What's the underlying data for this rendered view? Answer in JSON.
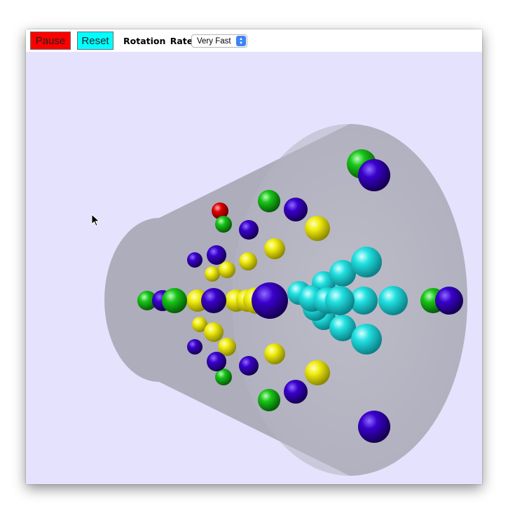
{
  "toolbar": {
    "pause_label": "Pause",
    "reset_label": "Reset",
    "rotation_rate_label": "Rotation Rate",
    "rotation_rate_value": "Very Fast"
  },
  "colors": {
    "pause": "#ff0000",
    "reset": "#00ffff",
    "viewport_bg": "#e4e2fc",
    "funnel": "#a9a8b6",
    "yellow": "#e6e200",
    "blue": "#3a00cc",
    "green": "#18c418",
    "cyan": "#22e0e0",
    "red": "#e00000"
  },
  "icons": {
    "cursor": "arrow-cursor-icon",
    "select": "chevron-updown-icon"
  }
}
